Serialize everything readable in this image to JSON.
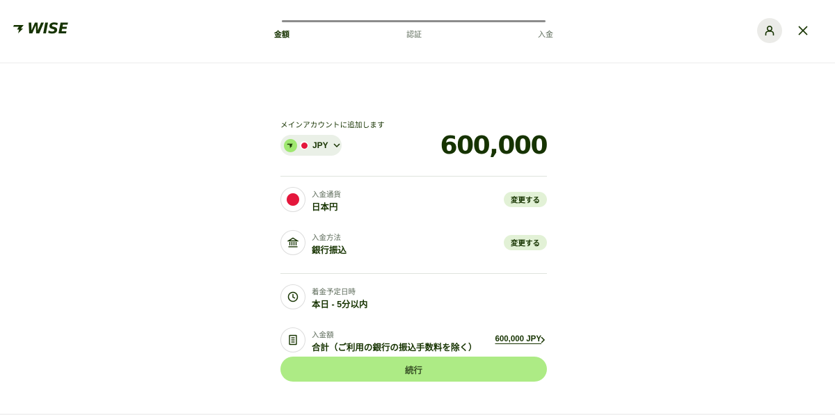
{
  "header": {
    "logo_text": "WISE",
    "steps": [
      {
        "label": "金額",
        "active": true
      },
      {
        "label": "認証",
        "active": false
      },
      {
        "label": "入金",
        "active": false
      }
    ]
  },
  "account": {
    "label": "メインアカウントに追加します",
    "currency_code": "JPY",
    "amount": "600,000"
  },
  "details": {
    "currency": {
      "sub": "入金通貨",
      "main": "日本円",
      "action": "変更する"
    },
    "method": {
      "sub": "入金方法",
      "main": "銀行振込",
      "action": "変更する"
    },
    "arrival": {
      "sub": "着金予定日時",
      "main": "本日 - 5分以内"
    },
    "total": {
      "sub": "入金額",
      "main": "合計（ご利用の銀行の振込手数料を除く）",
      "value": "600,000 JPY"
    }
  },
  "continue_label": "続行",
  "colors": {
    "brand_dark": "#163300",
    "brand_green": "#9fe870",
    "pill_bg": "#e2f1d6",
    "flag_red": "#e4173c"
  },
  "icons": [
    "wise-logo-icon",
    "user-icon",
    "close-icon",
    "japan-flag-icon",
    "chevron-down-icon",
    "bank-icon",
    "clock-icon",
    "receipt-icon",
    "chevron-right-icon"
  ]
}
